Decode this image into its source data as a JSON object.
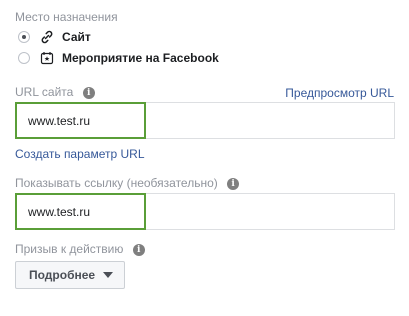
{
  "destination": {
    "label": "Место назначения",
    "options": [
      {
        "label": "Сайт",
        "icon": "link-icon",
        "selected": true
      },
      {
        "label": "Мероприятие на Facebook",
        "icon": "calendar-star-icon",
        "selected": false
      }
    ]
  },
  "url_field": {
    "label": "URL сайта",
    "info_icon": "i",
    "preview_link": "Предпросмотр URL",
    "value": "www.test.ru",
    "create_param_link": "Создать параметр URL"
  },
  "display_link": {
    "label": "Показывать ссылку",
    "optional": "(необязательно)",
    "info_icon": "i",
    "value": "www.test.ru"
  },
  "cta": {
    "label": "Призыв к действию",
    "info_icon": "i",
    "selected": "Подробнее"
  },
  "colors": {
    "label_gray": "#90949c",
    "link_blue": "#365899",
    "focus_green": "#5a9e38"
  }
}
